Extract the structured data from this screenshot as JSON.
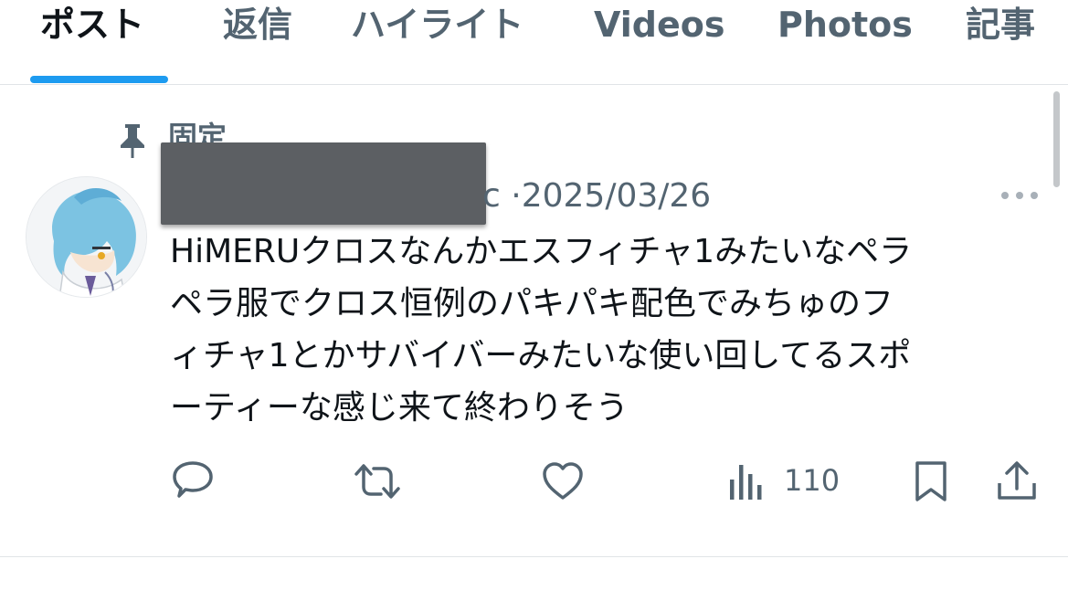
{
  "tabs": [
    {
      "label": "ポスト",
      "active": true
    },
    {
      "label": "返信",
      "active": false
    },
    {
      "label": "ハイライト",
      "active": false
    },
    {
      "label": "Videos",
      "active": false
    },
    {
      "label": "Photos",
      "active": false
    },
    {
      "label": "記事",
      "active": false
    }
  ],
  "post": {
    "pinned_label": "固定",
    "handle_fragment": "c",
    "separator": "·",
    "date": "2025/03/26",
    "text_lines": [
      "HiMERUクロスなんかエスフィチャ1みたいなペラ",
      "ペラ服でクロス恒例のパキパキ配色でみちゅのフ",
      "ィチャ1とかサバイバーみたいな使い回してるスポ",
      "ーティーな感じ来て終わりそう"
    ],
    "actions": {
      "reply_icon": "reply-icon",
      "repost_icon": "repost-icon",
      "like_icon": "like-icon",
      "views_icon": "views-icon",
      "views_count": "110",
      "bookmark_icon": "bookmark-icon",
      "share_icon": "share-icon"
    }
  },
  "colors": {
    "accent": "#1d9bf0",
    "text_primary": "#0f1419",
    "text_secondary": "#536471",
    "divider": "#e1e4e7",
    "redaction": "#5c5f63"
  }
}
